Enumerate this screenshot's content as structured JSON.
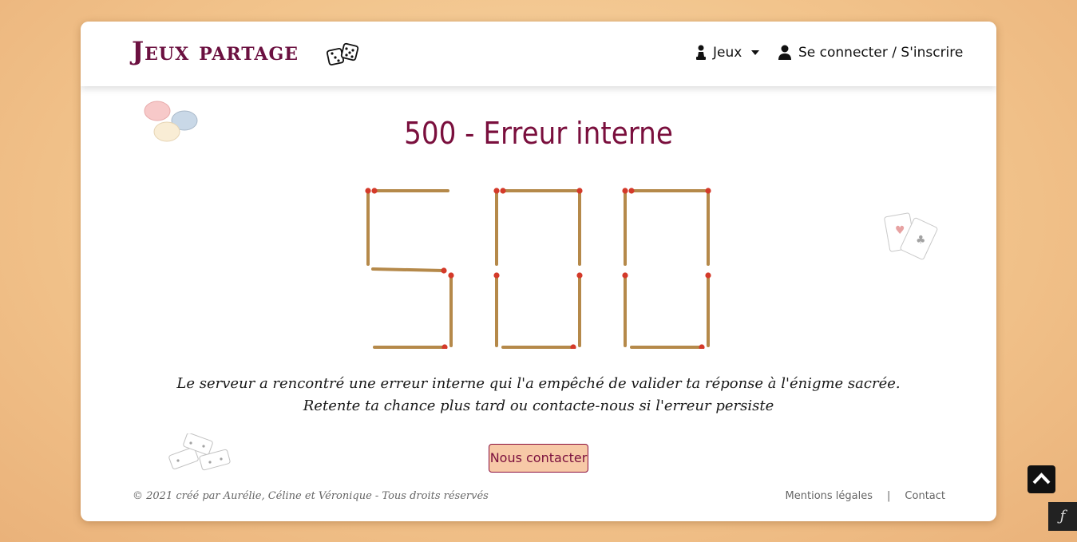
{
  "header": {
    "logo_text": "Jeux partage",
    "nav_games_label": "Jeux",
    "nav_login_label": "Se connecter / S'inscrire"
  },
  "main": {
    "title": "500 - Erreur interne",
    "matchstick_number": "500",
    "message_line1": "Le serveur a rencontré une erreur interne qui l'a empêché de valider ta réponse à l'énigme sacrée.",
    "message_line2": "Retente ta chance plus tard ou contacte-nous si l'erreur persiste",
    "contact_button_label": "Nous contacter"
  },
  "footer": {
    "copyright": "© 2021 créé par Aurélie, Céline et Véronique - Tous droits réservés",
    "legal_link": "Mentions légales",
    "separator": "|",
    "contact_link": "Contact"
  },
  "colors": {
    "brand": "#7a0f3d",
    "button_bg": "#f7c9a7",
    "match_wood": "#b5894a",
    "match_head": "#d43a2a"
  },
  "icons": {
    "dice": "dice-icon",
    "user_games": "chess-pawn-icon",
    "user_login": "user-icon",
    "scroll_top": "chevron-up-icon",
    "symfony": "symfony-icon"
  }
}
